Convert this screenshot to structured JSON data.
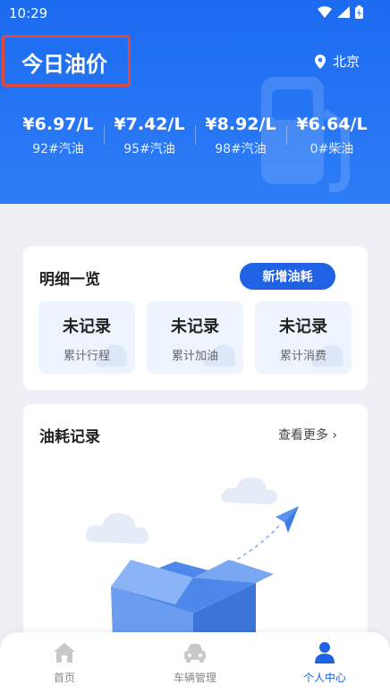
{
  "status_bar": {
    "time": "10:29"
  },
  "header": {
    "title": "今日油价",
    "location": "北京",
    "prices": [
      {
        "value": "¥6.97/L",
        "label": "92#汽油"
      },
      {
        "value": "¥7.42/L",
        "label": "95#汽油"
      },
      {
        "value": "¥8.92/L",
        "label": "98#汽油"
      },
      {
        "value": "¥6.64/L",
        "label": "0#柴油"
      }
    ]
  },
  "details": {
    "title": "明细一览",
    "add_button": "新增油耗",
    "stats": [
      {
        "value": "未记录",
        "label": "累计行程"
      },
      {
        "value": "未记录",
        "label": "累计加油"
      },
      {
        "value": "未记录",
        "label": "累计消费"
      }
    ]
  },
  "records": {
    "title": "油耗记录",
    "more": "查看更多 ›"
  },
  "tabbar": {
    "items": [
      {
        "label": "首页",
        "icon": "home-icon"
      },
      {
        "label": "车辆管理",
        "icon": "car-icon"
      },
      {
        "label": "个人中心",
        "icon": "person-icon"
      }
    ],
    "active": 2
  },
  "colors": {
    "primary": "#1f62e6",
    "header": "#2d7df8",
    "highlight_box": "#e14a3a"
  }
}
